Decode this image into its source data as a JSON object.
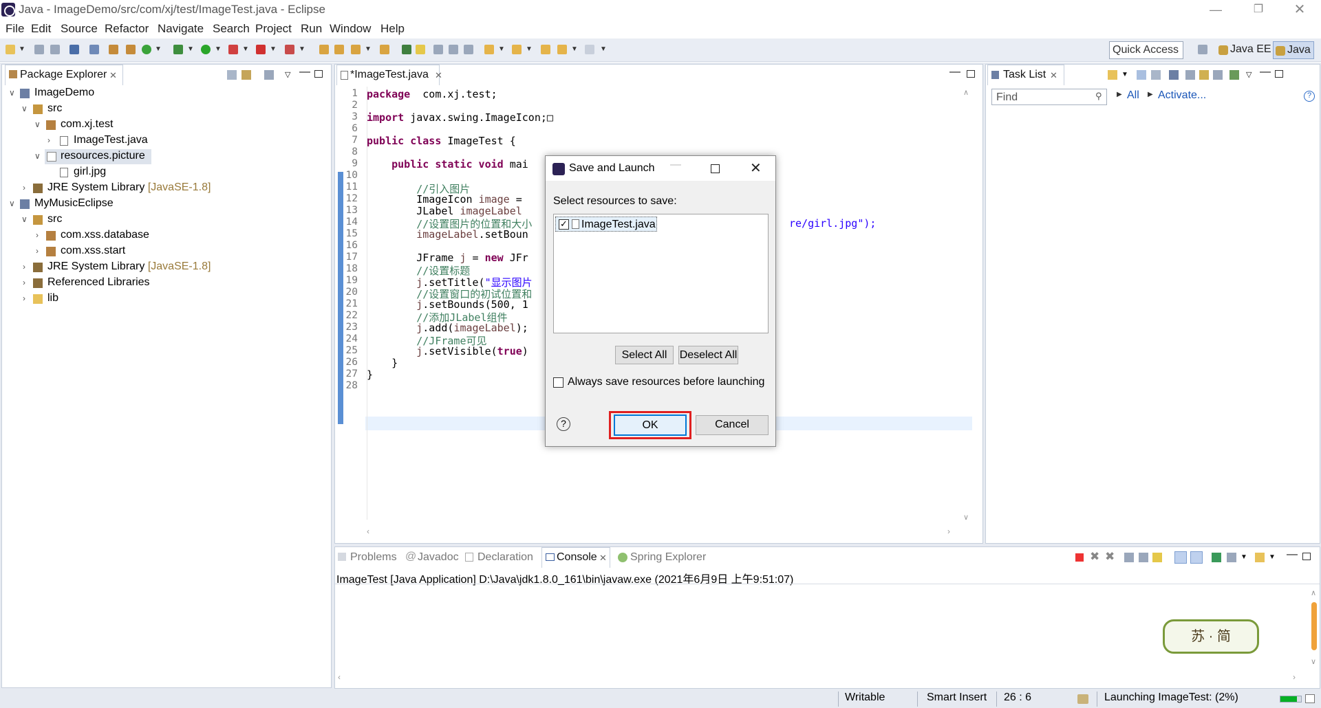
{
  "window": {
    "title": "Java - ImageDemo/src/com/xj/test/ImageTest.java - Eclipse"
  },
  "menu": [
    "File",
    "Edit",
    "Source",
    "Refactor",
    "Navigate",
    "Search",
    "Project",
    "Run",
    "Window",
    "Help"
  ],
  "toolbar": {
    "quick_access": "Quick Access",
    "perspectives": [
      "Java EE",
      "Java"
    ]
  },
  "package_explorer": {
    "tab": "Package Explorer",
    "tree": [
      {
        "label": "ImageDemo",
        "suffix": ""
      },
      {
        "label": "src",
        "suffix": ""
      },
      {
        "label": "com.xj.test",
        "suffix": ""
      },
      {
        "label": "ImageTest.java",
        "suffix": ""
      },
      {
        "label": "resources.picture",
        "suffix": ""
      },
      {
        "label": "girl.jpg",
        "suffix": ""
      },
      {
        "label": "JRE System Library",
        "suffix": "[JavaSE-1.8]"
      },
      {
        "label": "MyMusicEclipse",
        "suffix": ""
      },
      {
        "label": "src",
        "suffix": ""
      },
      {
        "label": "com.xss.database",
        "suffix": ""
      },
      {
        "label": "com.xss.start",
        "suffix": ""
      },
      {
        "label": "JRE System Library",
        "suffix": "[JavaSE-1.8]"
      },
      {
        "label": "Referenced Libraries",
        "suffix": ""
      },
      {
        "label": "lib",
        "suffix": ""
      }
    ]
  },
  "editor": {
    "tab": "*ImageTest.java",
    "lines": [
      {
        "n": "1",
        "segs": [
          [
            "kw",
            "package"
          ],
          [
            "",
            "  com.xj.test;"
          ]
        ]
      },
      {
        "n": "2",
        "segs": []
      },
      {
        "n": "3",
        "segs": [
          [
            "kw",
            "import"
          ],
          [
            "",
            " javax.swing.ImageIcon;□"
          ]
        ]
      },
      {
        "n": "6",
        "segs": []
      },
      {
        "n": "7",
        "segs": [
          [
            "kw",
            "public class"
          ],
          [
            "",
            " ImageTest {"
          ]
        ]
      },
      {
        "n": "8",
        "segs": []
      },
      {
        "n": "9",
        "segs": [
          [
            "",
            "    "
          ],
          [
            "kw",
            "public static void"
          ],
          [
            "",
            " mai"
          ]
        ]
      },
      {
        "n": "10",
        "segs": []
      },
      {
        "n": "11",
        "segs": [
          [
            "",
            "        "
          ],
          [
            "cm",
            "//引入图片"
          ]
        ]
      },
      {
        "n": "12",
        "segs": [
          [
            "",
            "        ImageIcon "
          ],
          [
            "fld",
            "image"
          ],
          [
            "",
            " ="
          ]
        ]
      },
      {
        "n": "13",
        "segs": [
          [
            "",
            "        JLabel "
          ],
          [
            "fld",
            "imageLabel"
          ]
        ]
      },
      {
        "n": "14",
        "segs": [
          [
            "",
            "        "
          ],
          [
            "cm",
            "//设置图片的位置和大小"
          ]
        ]
      },
      {
        "n": "15",
        "segs": [
          [
            "",
            "        "
          ],
          [
            "fld",
            "imageLabel"
          ],
          [
            "",
            ".setBoun"
          ]
        ]
      },
      {
        "n": "16",
        "segs": []
      },
      {
        "n": "17",
        "segs": [
          [
            "",
            "        JFrame "
          ],
          [
            "fld",
            "j"
          ],
          [
            "",
            " = "
          ],
          [
            "kw",
            "new"
          ],
          [
            "",
            " JFr"
          ]
        ]
      },
      {
        "n": "18",
        "segs": [
          [
            "",
            "        "
          ],
          [
            "cm",
            "//设置标题"
          ]
        ]
      },
      {
        "n": "19",
        "segs": [
          [
            "",
            "        "
          ],
          [
            "fld",
            "j"
          ],
          [
            "",
            ".setTitle("
          ],
          [
            "st",
            "\"显示图片"
          ]
        ]
      },
      {
        "n": "20",
        "segs": [
          [
            "",
            "        "
          ],
          [
            "cm",
            "//设置窗口的初试位置和"
          ]
        ]
      },
      {
        "n": "21",
        "segs": [
          [
            "",
            "        "
          ],
          [
            "fld",
            "j"
          ],
          [
            "",
            ".setBounds(500, 1"
          ]
        ]
      },
      {
        "n": "22",
        "segs": [
          [
            "",
            "        "
          ],
          [
            "cm",
            "//添加JLabel组件"
          ]
        ]
      },
      {
        "n": "23",
        "segs": [
          [
            "",
            "        "
          ],
          [
            "fld",
            "j"
          ],
          [
            "",
            ".add("
          ],
          [
            "fld",
            "imageLabel"
          ],
          [
            "",
            ");"
          ]
        ]
      },
      {
        "n": "24",
        "segs": [
          [
            "",
            "        "
          ],
          [
            "cm",
            "//JFrame可见"
          ]
        ]
      },
      {
        "n": "25",
        "segs": [
          [
            "",
            "        "
          ],
          [
            "fld",
            "j"
          ],
          [
            "",
            ".setVisible("
          ],
          [
            "kw",
            "true"
          ],
          [
            "",
            ")"
          ]
        ]
      },
      {
        "n": "26",
        "segs": [
          [
            "",
            "    }"
          ]
        ]
      },
      {
        "n": "27",
        "segs": [
          [
            "",
            "}"
          ]
        ]
      },
      {
        "n": "28",
        "segs": []
      }
    ],
    "right_fragment": "re/girl.jpg\");"
  },
  "task_list": {
    "tab": "Task List",
    "find_placeholder": "Find",
    "all": "All",
    "activate": "Activate..."
  },
  "console": {
    "tabs": [
      "Problems",
      "Javadoc",
      "Declaration",
      "Console",
      "Spring Explorer"
    ],
    "info": "ImageTest [Java Application] D:\\Java\\jdk1.8.0_161\\bin\\javaw.exe (2021年6月9日 上午9:51:07)",
    "watermark": "苏 · 简"
  },
  "status": {
    "writable": "Writable",
    "insert": "Smart Insert",
    "position": "26 : 6",
    "launching": "Launching ImageTest: (2%)",
    "progress": 0.02
  },
  "dialog": {
    "title": "Save and Launch",
    "prompt": "Select resources to save:",
    "resource": "ImageTest.java",
    "select_all": "Select All",
    "deselect_all": "Deselect All",
    "always_save": "Always save resources before launching",
    "ok": "OK",
    "cancel": "Cancel",
    "help": "?"
  }
}
